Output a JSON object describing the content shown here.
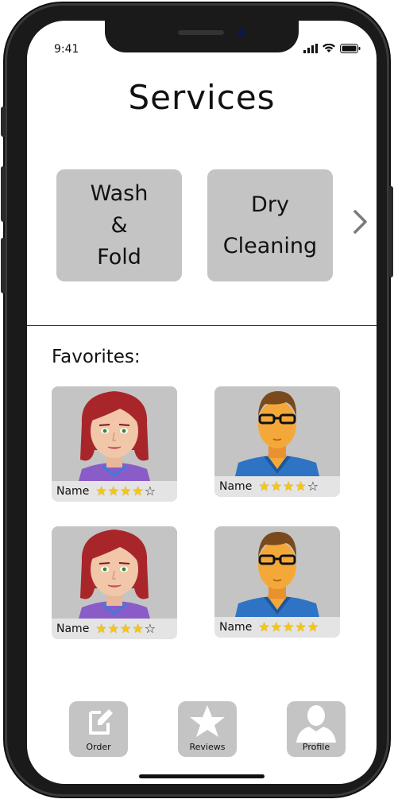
{
  "status_bar": {
    "time": "9:41"
  },
  "page": {
    "title": "Services"
  },
  "services": [
    {
      "label": "Wash\n&\nFold"
    },
    {
      "label": "Dry\nCleaning"
    }
  ],
  "favorites": {
    "heading": "Favorites:",
    "items": [
      {
        "name": "Name",
        "avatar": "woman-avatar",
        "rating": 4,
        "max_rating": 5
      },
      {
        "name": "Name",
        "avatar": "man-avatar",
        "rating": 4,
        "max_rating": 5
      },
      {
        "name": "Name",
        "avatar": "woman-avatar",
        "rating": 4,
        "max_rating": 5
      },
      {
        "name": "Name",
        "avatar": "man-avatar",
        "rating": 5,
        "max_rating": 5
      }
    ]
  },
  "bottom_nav": [
    {
      "label": "Order",
      "icon": "edit-icon"
    },
    {
      "label": "Reviews",
      "icon": "star-icon"
    },
    {
      "label": "Profile",
      "icon": "profile-icon"
    }
  ],
  "colors": {
    "card_gray": "#c4c4c4",
    "caption_gray": "#e4e4e4",
    "star_gold": "#f5c518"
  }
}
